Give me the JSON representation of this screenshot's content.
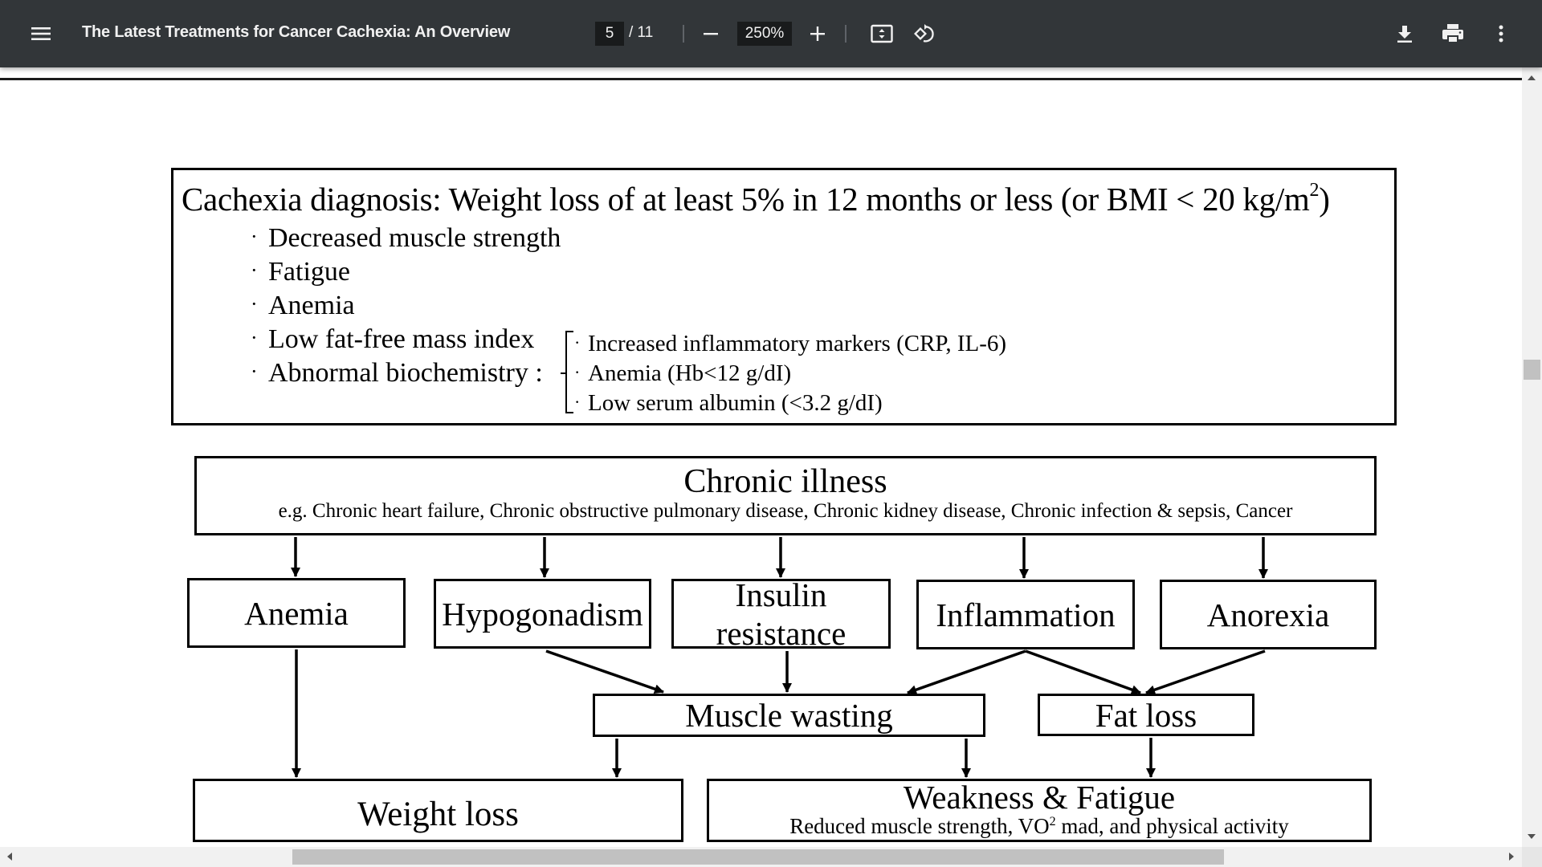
{
  "toolbar": {
    "menu_icon": "hamburger-menu-icon",
    "title": "The Latest Treatments for Cancer Cachexia: An Overview",
    "current_page": "5",
    "total_pages": "/ 11",
    "zoom_out_icon": "minus-icon",
    "zoom_level": "250%",
    "zoom_in_icon": "plus-icon",
    "fit_page_icon": "fit-to-page-icon",
    "rotate_icon": "rotate-counterclockwise-icon",
    "download_icon": "download-icon",
    "print_icon": "print-icon",
    "more_icon": "more-vertical-icon"
  },
  "document": {
    "criteria": {
      "heading": "Cachexia diagnosis: Weight loss of at least 5% in 12 months or less (or BMI < 20 kg/m",
      "heading_sup": "2",
      "heading_end": ")",
      "bullet_symbol": "·",
      "items": [
        "Decreased muscle strength",
        "Fatigue",
        "Anemia",
        "Low fat-free mass index",
        "Abnormal biochemistry :"
      ],
      "sub_items": [
        "Increased inflammatory markers (CRP, IL-6)",
        "Anemia (Hb<12 g/dI)",
        "Low serum albumin (<3.2 g/dI)"
      ]
    },
    "flow": {
      "chronic_title": "Chronic illness",
      "chronic_examples": "e.g. Chronic heart failure, Chronic obstructive pulmonary disease, Chronic kidney disease, Chronic infection & sepsis, Cancer",
      "mechanisms": {
        "anemia": "Anemia",
        "hypogonadism": "Hypogonadism",
        "insulin_line1": "Insulin",
        "insulin_line2": "resistance",
        "inflammation": "Inflammation",
        "anorexia": "Anorexia"
      },
      "muscle_wasting": "Muscle wasting",
      "fat_loss": "Fat loss",
      "weight_loss": "Weight loss",
      "weakness_title": "Weakness & Fatigue",
      "weakness_sub_pre": "Reduced muscle strength, VO",
      "weakness_sub_sup": "2",
      "weakness_sub_post": " mad, and physical activity"
    }
  },
  "colors": {
    "toolbar_bg": "#323639",
    "toolbar_text": "#f1f1f1",
    "input_bg": "#191b1c",
    "scrollbar_track": "#f1f1f1",
    "scrollbar_thumb": "#c1c1c1"
  }
}
